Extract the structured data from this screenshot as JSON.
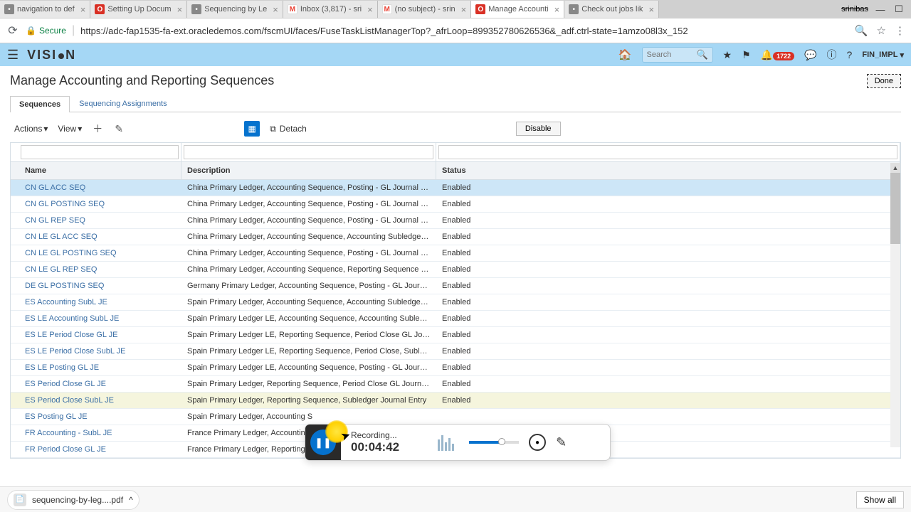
{
  "browser": {
    "tabs": [
      {
        "label": "navigation to def",
        "icon": "generic"
      },
      {
        "label": "Setting Up Docum",
        "icon": "oracle"
      },
      {
        "label": "Sequencing by Le",
        "icon": "generic"
      },
      {
        "label": "Inbox (3,817) - sri",
        "icon": "gmail"
      },
      {
        "label": "(no subject) - srin",
        "icon": "gmail"
      },
      {
        "label": "Manage Accounti",
        "icon": "oracle",
        "active": true
      },
      {
        "label": "Check out jobs lik",
        "icon": "generic"
      }
    ],
    "profile": "srinibas",
    "url": "https://adc-fap1535-fa-ext.oracledemos.com/fscmUI/faces/FuseTaskListManagerTop?_afrLoop=899352780626536&_adf.ctrl-state=1amzo08l3x_152",
    "secure_label": "Secure"
  },
  "header": {
    "logo": "VISION",
    "search_placeholder": "Search",
    "badge": "1722",
    "user": "FIN_IMPL"
  },
  "page": {
    "title": "Manage Accounting and Reporting Sequences",
    "done": "Done",
    "tabs": [
      "Sequences",
      "Sequencing Assignments"
    ],
    "active_tab": 0
  },
  "toolbar": {
    "actions": "Actions",
    "view": "View",
    "detach": "Detach",
    "disable": "Disable"
  },
  "table": {
    "headers": {
      "name": "Name",
      "description": "Description",
      "status": "Status"
    },
    "rows": [
      {
        "name": "CN GL ACC SEQ",
        "desc": "China Primary Ledger, Accounting Sequence, Posting - GL Journal Entry",
        "status": "Enabled",
        "selected": true
      },
      {
        "name": "CN GL POSTING SEQ",
        "desc": "China Primary Ledger, Accounting Sequence, Posting - GL Journal Entry",
        "status": "Enabled"
      },
      {
        "name": "CN GL REP SEQ",
        "desc": "China Primary Ledger, Accounting Sequence, Posting - GL Journal Entry",
        "status": "Enabled"
      },
      {
        "name": "CN LE GL ACC SEQ",
        "desc": "China Primary Ledger, Accounting Sequence, Accounting Subledger Journal Entry...",
        "status": "Enabled"
      },
      {
        "name": "CN LE GL POSTING SEQ",
        "desc": "China Primary Ledger, Accounting Sequence, Posting - GL Journal Entry by Legal ...",
        "status": "Enabled"
      },
      {
        "name": "CN LE GL REP SEQ",
        "desc": "China Primary Ledger, Accounting Sequence, Reporting Sequence by Legal Entity",
        "status": "Enabled"
      },
      {
        "name": "DE GL POSTING SEQ",
        "desc": "Germany Primary Ledger, Accounting Sequence, Posting - GL Journal Entry",
        "status": "Enabled"
      },
      {
        "name": "ES Accounting SubL JE",
        "desc": "Spain Primary Ledger, Accounting Sequence, Accounting Subledger Journal Entry",
        "status": "Enabled"
      },
      {
        "name": "ES LE Accounting SubL JE",
        "desc": "Spain Primary Ledger LE, Accounting Sequence, Accounting Subledger Journal E...",
        "status": "Enabled"
      },
      {
        "name": "ES LE Period Close GL JE",
        "desc": "Spain Primary Ledger LE, Reporting Sequence, Period Close GL Journal Entry",
        "status": "Enabled"
      },
      {
        "name": "ES LE Period Close SubL JE",
        "desc": "Spain Primary Ledger LE, Reporting Sequence, Period Close, Subledger Journal ...",
        "status": "Enabled"
      },
      {
        "name": "ES LE Posting GL JE",
        "desc": "Spain Primary Ledger LE, Accounting Sequence, Posting - GL Journal Entry",
        "status": "Enabled"
      },
      {
        "name": "ES Period Close GL JE",
        "desc": "Spain Primary Ledger, Reporting Sequence, Period Close GL Journal Entry",
        "status": "Enabled"
      },
      {
        "name": "ES Period Close SubL JE",
        "desc": "Spain Primary Ledger, Reporting Sequence, Subledger Journal Entry",
        "status": "Enabled",
        "highlighted": true
      },
      {
        "name": "ES Posting GL JE",
        "desc": "Spain Primary Ledger, Accounting S",
        "status": ""
      },
      {
        "name": "FR Accounting - SubL JE",
        "desc": "France Primary Ledger, Accounting",
        "status": ""
      },
      {
        "name": "FR Period Close GL JE",
        "desc": "France Primary Ledger, Reporting S",
        "status": ""
      }
    ]
  },
  "recorder": {
    "label": "Recording...",
    "time": "00:04:42"
  },
  "download": {
    "file": "sequencing-by-leg....pdf",
    "showall": "Show all"
  }
}
